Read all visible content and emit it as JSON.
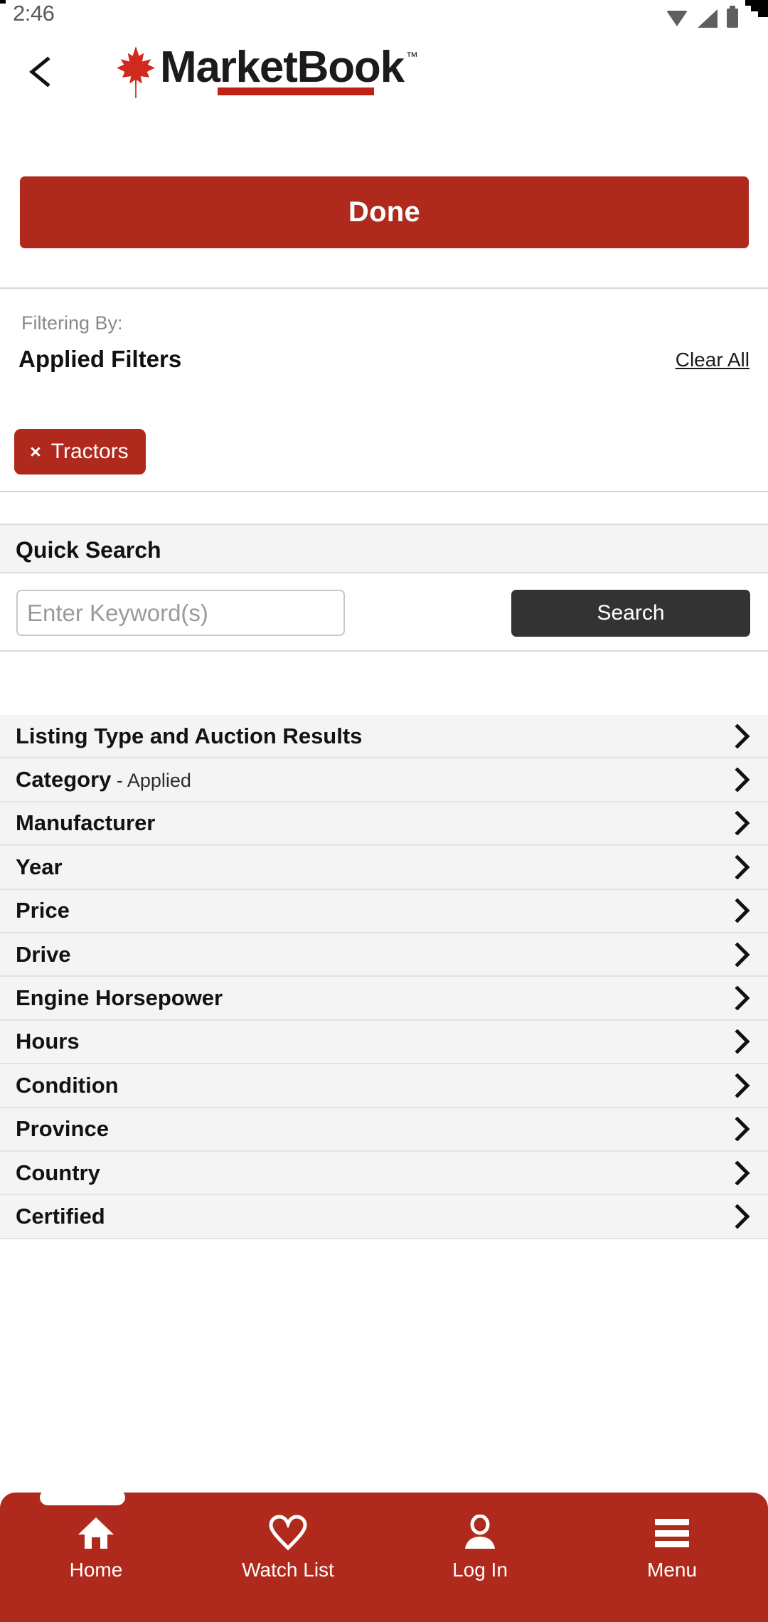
{
  "status_bar": {
    "time": "2:46",
    "icons": [
      "wifi-icon",
      "cellular-signal-icon",
      "battery-icon"
    ]
  },
  "header": {
    "back_icon": "chevron-left-icon",
    "logo_text": "MarketBook",
    "logo_tm": "™",
    "logo_leaf_icon": "maple-leaf-icon"
  },
  "done_button": {
    "label": "Done"
  },
  "filters_card": {
    "filtering_by_label": "Filtering By:",
    "applied_title": "Applied Filters",
    "clear_all_label": "Clear All",
    "chips": [
      {
        "remove_icon": "×",
        "label": "Tractors"
      }
    ]
  },
  "quick_search": {
    "section_title": "Quick Search",
    "input_value": "",
    "input_placeholder": "Enter Keyword(s)",
    "search_button_label": "Search"
  },
  "filter_rows": [
    {
      "label": "Listing Type and Auction Results",
      "status": ""
    },
    {
      "label": "Category",
      "status": " - Applied"
    },
    {
      "label": "Manufacturer",
      "status": ""
    },
    {
      "label": "Year",
      "status": ""
    },
    {
      "label": "Price",
      "status": ""
    },
    {
      "label": "Drive",
      "status": ""
    },
    {
      "label": "Engine Horsepower",
      "status": ""
    },
    {
      "label": "Hours",
      "status": ""
    },
    {
      "label": "Condition",
      "status": ""
    },
    {
      "label": "Province",
      "status": ""
    },
    {
      "label": "Country",
      "status": ""
    },
    {
      "label": "Certified",
      "status": ""
    }
  ],
  "bottom_nav": {
    "items": [
      {
        "label": "Home",
        "icon": "home-icon"
      },
      {
        "label": "Watch List",
        "icon": "heart-icon"
      },
      {
        "label": "Log In",
        "icon": "person-icon"
      },
      {
        "label": "Menu",
        "icon": "hamburger-menu-icon"
      }
    ]
  },
  "colors": {
    "brand_red": "#af2a1c",
    "logo_bar_red": "#bf2116",
    "search_button_dark": "#333333",
    "row_background": "#f4f4f4"
  }
}
